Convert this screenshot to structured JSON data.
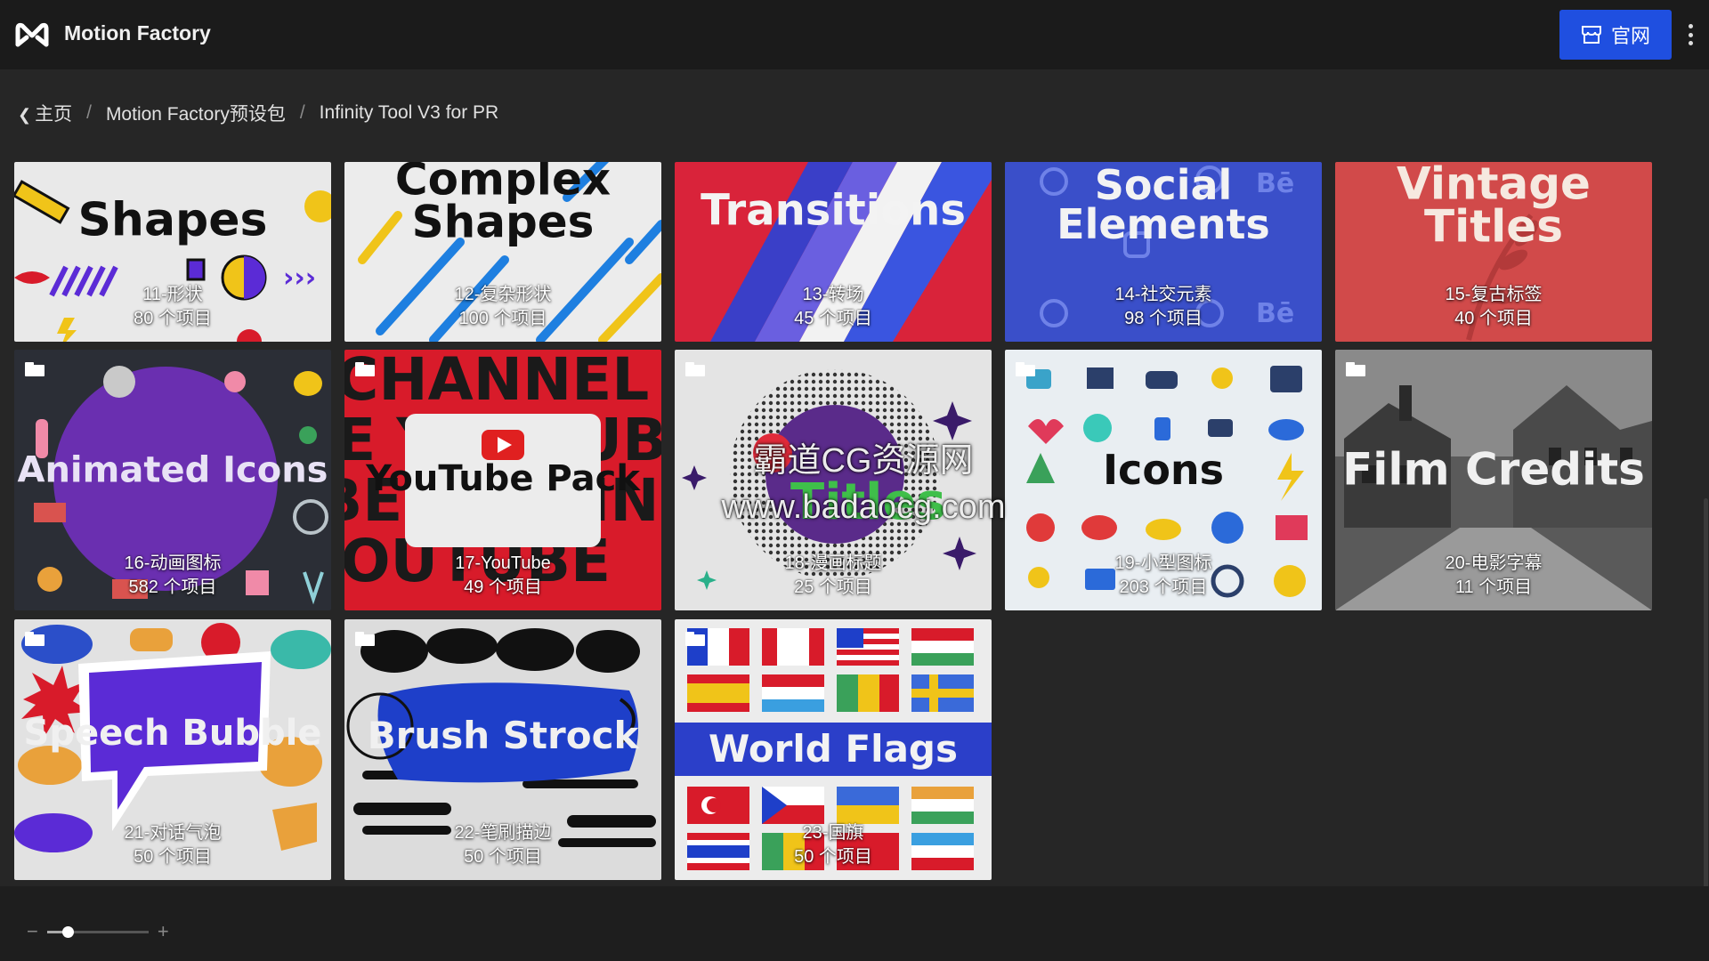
{
  "header": {
    "app_title": "Motion Factory",
    "site_button_label": "官网",
    "accent_color": "#1f4fe0"
  },
  "breadcrumb": {
    "home": "主页",
    "level1": "Motion Factory预设包",
    "level2": "Infinity Tool V3 for PR",
    "separator": "/"
  },
  "tiles": [
    {
      "headline": "Shapes",
      "name": "11-形状",
      "count": "80 个项目"
    },
    {
      "headline": "Complex Shapes",
      "name": "12-复杂形状",
      "count": "100 个项目"
    },
    {
      "headline": "Transitions",
      "name": "13-转场",
      "count": "45 个项目"
    },
    {
      "headline": "Social Elements",
      "name": "14-社交元素",
      "count": "98 个项目"
    },
    {
      "headline": "Vintage Titles",
      "name": "15-复古标签",
      "count": "40 个项目"
    },
    {
      "headline": "Animated Icons",
      "name": "16-动画图标",
      "count": "582 个项目"
    },
    {
      "headline": "YouTube Pack",
      "name": "17-YouTube",
      "count": "49 个项目"
    },
    {
      "headline": "Comic Titles",
      "name": "18-漫画标题",
      "count": "25 个项目"
    },
    {
      "headline": "Icons",
      "name": "19-小型图标",
      "count": "203 个项目"
    },
    {
      "headline": "Film Credits",
      "name": "20-电影字幕",
      "count": "11 个项目"
    },
    {
      "headline": "Speech Bubble",
      "name": "21-对话气泡",
      "count": "50 个项目"
    },
    {
      "headline": "Brush Strock",
      "name": "22-笔刷描边",
      "count": "50 个项目"
    },
    {
      "headline": "World Flags",
      "name": "23-国旗",
      "count": "50 个项目"
    }
  ],
  "watermark": {
    "line1": "霸道CG资源网",
    "line2": "www.badaocg.com"
  },
  "zoom": {
    "minus": "−",
    "plus": "+",
    "level": 0.2
  }
}
